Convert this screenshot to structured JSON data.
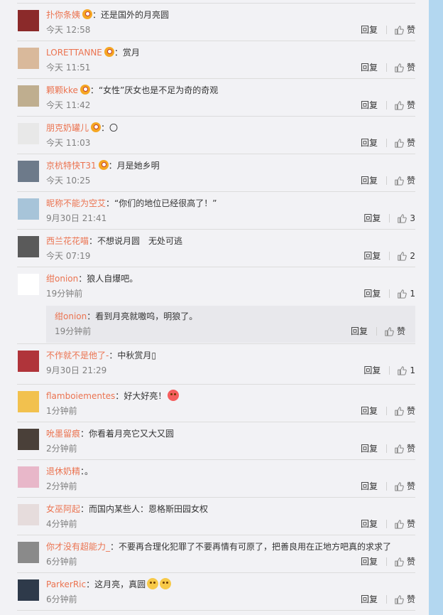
{
  "colors": {
    "username": "#eb7350",
    "background": "#f2f2f5",
    "divider": "#dcdcdc",
    "scrollbar": "#b3d7f0"
  },
  "labels": {
    "reply": "回复",
    "like": "赞"
  },
  "comments": [
    {
      "user": "扑你条姨",
      "badge": true,
      "text": "还是国外的月亮圆",
      "time": "今天 12:58",
      "likes": "赞",
      "avatar_color": "#8b2a2a"
    },
    {
      "user": "LORETTANNE",
      "badge": true,
      "text": "赏月",
      "time": "今天 11:51",
      "likes": "赞",
      "avatar_color": "#d9b99b"
    },
    {
      "user": "颗颗kke",
      "badge": true,
      "text": "“女性”厌女也是不足为奇的奇观",
      "time": "今天 11:42",
      "likes": "赞",
      "avatar_color": "#bfae8f"
    },
    {
      "user": "朋克奶罐儿",
      "badge": true,
      "text": "〇",
      "time": "今天 11:03",
      "likes": "赞",
      "avatar_color": "#e8e8e8"
    },
    {
      "user": "京杭特快T31",
      "badge": true,
      "text": "月是她乡明",
      "time": "今天 10:25",
      "likes": "赞",
      "avatar_color": "#6d7a8a"
    },
    {
      "user": "昵称不能为空艾",
      "badge": false,
      "text": "“你们的地位已经很高了！”",
      "time": "9月30日 21:41",
      "likes": "3",
      "avatar_color": "#a7c4d9"
    },
    {
      "user": "西兰花花喵",
      "badge": false,
      "text": "不想说月圆　无处可逃",
      "time": "今天 07:19",
      "likes": "2",
      "avatar_color": "#5a5a5a"
    },
    {
      "user": "绀onion",
      "badge": false,
      "text": "狼人自爆吧。",
      "time": "19分钟前",
      "likes": "1",
      "avatar_color": "#ffffff",
      "reply": {
        "user": "绀onion",
        "text": "看到月亮就嗷呜，明狼了。",
        "time": "19分钟前",
        "likes": "赞"
      }
    },
    {
      "user": "不作就不是他了-",
      "badge": false,
      "text": "中秋赏月▯",
      "time": "9月30日 21:29",
      "likes": "1",
      "avatar_color": "#b0343a"
    },
    {
      "user": "flamboiementes",
      "badge": false,
      "text": "好大好亮！",
      "time": "1分钟前",
      "likes": "赞",
      "avatar_color": "#f2c14e",
      "emoji": "heart"
    },
    {
      "user": "吮墨留痕",
      "badge": false,
      "text": "你看着月亮它又大又圆",
      "time": "2分钟前",
      "likes": "赞",
      "avatar_color": "#4a4039"
    },
    {
      "user": "退休奶精",
      "badge": false,
      "text": "。",
      "time": "2分钟前",
      "likes": "赞",
      "avatar_color": "#e8b7c9"
    },
    {
      "user": "女巫阿起",
      "badge": false,
      "text": "而国内某些人：恩格斯田园女权",
      "time": "4分钟前",
      "likes": "赞",
      "avatar_color": "#e6dcdc"
    },
    {
      "user": "你才没有超能力_",
      "badge": false,
      "text": "不要再合理化犯罪了不要再情有可原了，把善良用在正地方吧真的求求了",
      "time": "6分钟前",
      "likes": "赞",
      "avatar_color": "#8a8a8a"
    },
    {
      "user": "ParkerRic",
      "badge": false,
      "text": "这月亮，真圆",
      "time": "6分钟前",
      "likes": "赞",
      "avatar_color": "#2e3a4a",
      "emoji": "double"
    }
  ]
}
